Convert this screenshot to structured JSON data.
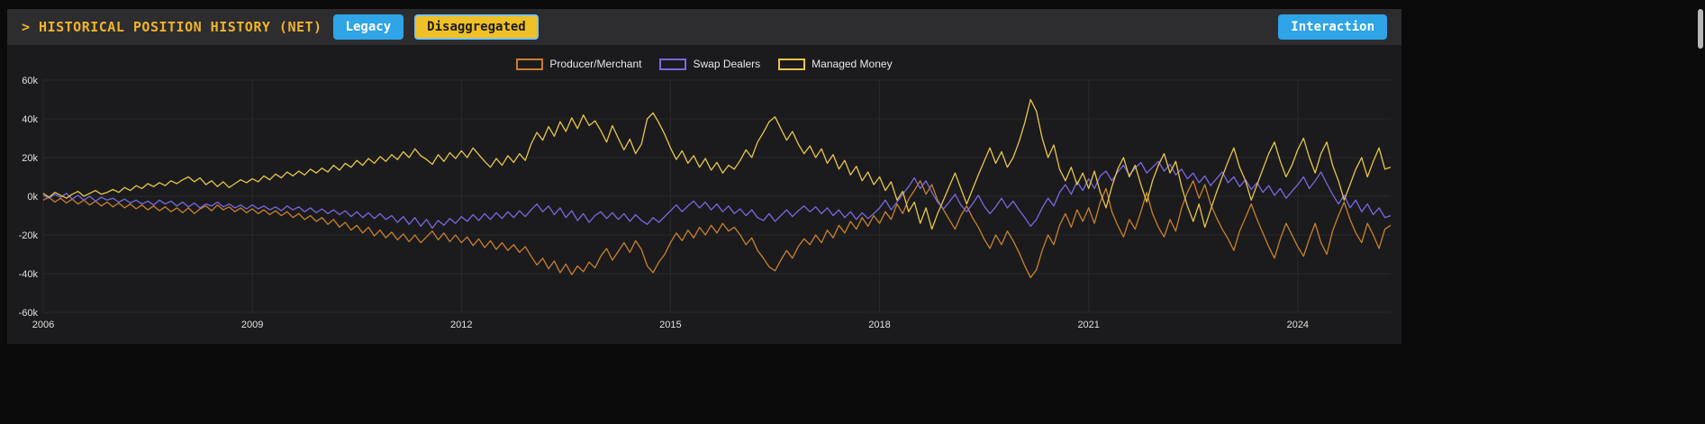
{
  "header": {
    "title": "> HISTORICAL POSITION HISTORY (NET)",
    "buttons": {
      "legacy": "Legacy",
      "disaggregated": "Disaggregated",
      "interaction": "Interaction"
    },
    "selected_view": "Disaggregated"
  },
  "colors": {
    "accent_blue": "#2fa4e7",
    "accent_gold": "#f0c027",
    "selected_border_blue": "#7cc4f0",
    "title_gold": "#f0b429",
    "panel_bg": "#1b1b1d",
    "topbar_bg": "#2d2d30",
    "grid": "#2a2a2c",
    "axis_text": "#e0e0e0"
  },
  "chart_data": {
    "type": "line",
    "title": "",
    "xlabel": "",
    "ylabel": "",
    "grid": true,
    "legend_position": "top-center",
    "x_range": [
      2006,
      2025.3333
    ],
    "y_range": [
      -60,
      60
    ],
    "x_ticks": [
      2006,
      2009,
      2012,
      2015,
      2018,
      2021,
      2024
    ],
    "y_tick_values": [
      60,
      40,
      20,
      0,
      -20,
      -40,
      -60
    ],
    "y_tick_labels": [
      "60k",
      "40k",
      "20k",
      "0k",
      "-20k",
      "-40k",
      "-60k"
    ],
    "y_unit": "k",
    "x_start": 2006.0,
    "x_step": 0.0833333,
    "series": [
      {
        "name": "Producer/Merchant",
        "color": "#c8802c",
        "values": [
          -2,
          -0.5,
          -3,
          -1,
          -3.5,
          -1.5,
          -4,
          -2,
          -4.5,
          -2.5,
          -5,
          -3,
          -5.5,
          -3.5,
          -6,
          -4,
          -6.5,
          -4.5,
          -7,
          -5,
          -7.5,
          -5.5,
          -8,
          -6,
          -8.5,
          -6,
          -9,
          -6.5,
          -5,
          -7.5,
          -4.5,
          -7,
          -5.5,
          -8,
          -6,
          -8.5,
          -6.5,
          -9,
          -7,
          -9.5,
          -7.5,
          -10,
          -8,
          -11,
          -9,
          -12,
          -10,
          -13,
          -11,
          -14.5,
          -12,
          -16,
          -13.5,
          -17.5,
          -15,
          -19,
          -16,
          -20.5,
          -17.5,
          -21.5,
          -18.5,
          -22.5,
          -19.5,
          -23.5,
          -20,
          -24,
          -21,
          -18,
          -22.5,
          -19,
          -23.5,
          -20,
          -24,
          -21,
          -25.5,
          -22,
          -26.5,
          -23,
          -27.5,
          -24,
          -28,
          -25,
          -29,
          -26,
          -31,
          -35.5,
          -32,
          -37.5,
          -33.5,
          -39.5,
          -35,
          -40.5,
          -36,
          -39,
          -34,
          -37,
          -31,
          -27,
          -33,
          -28.5,
          -24,
          -29,
          -23,
          -27.5,
          -36,
          -39.5,
          -34,
          -30,
          -24,
          -19,
          -23,
          -17.5,
          -21.5,
          -16,
          -20,
          -15,
          -19,
          -14,
          -18,
          -16,
          -20,
          -25,
          -21.5,
          -28,
          -32,
          -36.5,
          -38.5,
          -33,
          -28,
          -32,
          -26,
          -22,
          -25,
          -20,
          -24,
          -17.5,
          -21.5,
          -15,
          -19,
          -13,
          -17,
          -11,
          -15.5,
          -10,
          -14,
          -8,
          -12,
          -4,
          -9,
          -1.5,
          3,
          8,
          1,
          6,
          -2,
          -7,
          -12,
          -17,
          -10,
          -5,
          -11,
          -16,
          -22,
          -27,
          -20,
          -25,
          -18,
          -23,
          -29,
          -36,
          -42,
          -38,
          -28,
          -20,
          -25,
          -15,
          -9,
          -16,
          -7,
          -13,
          -6,
          -14,
          -3,
          4,
          -8,
          -15,
          -21,
          -12,
          -17,
          -8,
          2,
          -9,
          -16,
          -21,
          -12,
          -18,
          -6,
          2,
          8,
          -1,
          6,
          -4,
          -11,
          -17,
          -22,
          -28,
          -18,
          -11,
          -4,
          -12,
          -19,
          -26,
          -32,
          -22,
          -14,
          -20,
          -26,
          -31,
          -22,
          -14,
          -24,
          -30,
          -18,
          -10,
          -3,
          -12,
          -19,
          -24,
          -14,
          -20,
          -27,
          -17,
          -15
        ]
      },
      {
        "name": "Swap Dealers",
        "color": "#7a68e0",
        "values": [
          0.5,
          -1,
          1,
          -0.5,
          1.5,
          -1.5,
          0.5,
          -2,
          0,
          -2.5,
          -0.5,
          -2,
          -1,
          -3,
          -1.5,
          -3.5,
          -2,
          -4,
          -2.5,
          -4.5,
          -2,
          -4,
          -2.5,
          -5,
          -3,
          -5.5,
          -3.5,
          -6,
          -4,
          -5,
          -3,
          -5.5,
          -4,
          -6,
          -4.5,
          -6.5,
          -4.5,
          -6.5,
          -5,
          -7,
          -5.5,
          -7.5,
          -5,
          -7,
          -5.5,
          -8,
          -6,
          -8.5,
          -6.5,
          -9,
          -7,
          -9.5,
          -7.5,
          -10.5,
          -8,
          -11,
          -8.5,
          -11.5,
          -9,
          -12,
          -10,
          -13.5,
          -10.5,
          -14.5,
          -11,
          -15.5,
          -12,
          -16.5,
          -12.5,
          -15,
          -11.5,
          -14,
          -10.5,
          -13,
          -9.5,
          -12.5,
          -9,
          -12,
          -8.5,
          -11.5,
          -8,
          -11,
          -7.5,
          -10.5,
          -7,
          -4,
          -8,
          -5,
          -9.5,
          -6,
          -11,
          -7.5,
          -12.5,
          -9,
          -13.5,
          -10,
          -8,
          -11.5,
          -8.5,
          -12,
          -9,
          -13,
          -9.5,
          -12.5,
          -14.5,
          -11,
          -13.5,
          -10.5,
          -7.5,
          -4.5,
          -8,
          -5,
          -2.5,
          -6,
          -3,
          -7,
          -4,
          -8,
          -5,
          -9,
          -6.5,
          -10,
          -7,
          -11,
          -12.5,
          -9,
          -13,
          -10,
          -7,
          -10.5,
          -7.5,
          -5,
          -8,
          -5.5,
          -9,
          -6,
          -10,
          -7,
          -11,
          -8,
          -12,
          -8.5,
          -11.5,
          -9,
          -6,
          -2,
          -7,
          -3,
          1,
          5,
          9.5,
          4,
          8,
          2,
          -3,
          -6.5,
          -3,
          1,
          -4.5,
          -8,
          -4,
          0.5,
          -5,
          -9,
          -5.5,
          -1,
          -6,
          -2.5,
          -7,
          -11,
          -15.5,
          -12,
          -6,
          -1,
          -5,
          2,
          6,
          1,
          7.5,
          3,
          9,
          4,
          10.5,
          13,
          8,
          12.5,
          16,
          11,
          14.5,
          17.5,
          12,
          15,
          18,
          13,
          16.5,
          11,
          14,
          9,
          12,
          7,
          10.5,
          5.5,
          9,
          12.5,
          7,
          10,
          5,
          8.5,
          3.5,
          7,
          2,
          5.5,
          0.5,
          4,
          -1,
          2.5,
          6,
          10,
          4,
          8,
          12.5,
          6.5,
          1,
          -4,
          0.5,
          -6,
          -2,
          -8,
          -4,
          -9.5,
          -6,
          -11,
          -10
        ]
      },
      {
        "name": "Managed Money",
        "color": "#e8c54a",
        "values": [
          1.5,
          -0.5,
          2,
          0.5,
          -1,
          1,
          2.5,
          0,
          1.5,
          3,
          1,
          2,
          3.5,
          2,
          4.5,
          3,
          5.5,
          4,
          6.5,
          5,
          7,
          5.5,
          8,
          6.5,
          8.5,
          10,
          7.5,
          9.5,
          6,
          8,
          5,
          7.5,
          4.5,
          6.5,
          8.5,
          7,
          9,
          7.5,
          10.5,
          8.5,
          11.5,
          9.5,
          12.5,
          10.5,
          13,
          11,
          14,
          12,
          14.5,
          12.5,
          16,
          13.5,
          17,
          15,
          18.5,
          16,
          19.5,
          17,
          20.5,
          18,
          21.5,
          19,
          23,
          20,
          24.5,
          21,
          19,
          16.5,
          21.5,
          18,
          22.5,
          19.5,
          23.5,
          20,
          25,
          21.5,
          18,
          15,
          19.5,
          16,
          21,
          17.5,
          22,
          18.5,
          27,
          33,
          29,
          36,
          31,
          38.5,
          33.5,
          40.5,
          35,
          42,
          36.5,
          39,
          34,
          28,
          36.5,
          30,
          24,
          29.5,
          22,
          27,
          40,
          43,
          38,
          32,
          25,
          19,
          23.5,
          17,
          21,
          15,
          19.5,
          13.5,
          17.5,
          12,
          16,
          14,
          18.5,
          24,
          20,
          28,
          33,
          38.5,
          41,
          35,
          29,
          33.5,
          27,
          22,
          26,
          20,
          24.5,
          17,
          21.5,
          14,
          18.5,
          11,
          15.5,
          8,
          12.5,
          6,
          10,
          3,
          7.5,
          -2,
          2.5,
          -8,
          -3,
          -14,
          -6,
          -17,
          -9,
          -2,
          5,
          12,
          4,
          -4,
          3.5,
          11,
          18,
          25,
          17,
          23,
          15,
          20,
          28,
          38,
          50,
          44,
          30,
          20,
          26.5,
          14,
          8,
          15,
          6,
          12,
          4,
          13,
          2,
          -6,
          5,
          14,
          20,
          10,
          16,
          6,
          -3,
          8,
          16,
          22,
          12,
          18,
          5,
          -5,
          -13,
          -4,
          -16,
          -7,
          2,
          10,
          18,
          25,
          15,
          8,
          -2,
          6,
          14,
          22,
          28,
          18,
          10,
          16,
          24,
          30,
          20,
          12,
          22,
          28,
          16,
          8,
          -2,
          6,
          14,
          20,
          10,
          18,
          25,
          14,
          15
        ]
      }
    ]
  }
}
